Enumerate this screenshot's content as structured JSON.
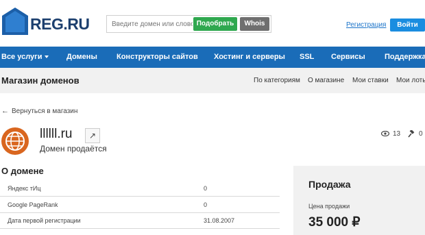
{
  "header": {
    "logo_text": "REG.RU",
    "search_placeholder": "Введите домен или слово",
    "pick_button": "Подобрать",
    "whois_button": "Whois",
    "register_link": "Регистрация",
    "login_button": "Войти"
  },
  "nav": {
    "items": [
      "Все услуги",
      "Домены",
      "Конструкторы сайтов",
      "Хостинг и серверы",
      "SSL",
      "Сервисы",
      "Поддержка"
    ]
  },
  "subbar": {
    "title": "Магазин доменов",
    "links": [
      "По категориям",
      "О магазине",
      "Мои ставки",
      "Мои лоты"
    ]
  },
  "back_link": "Вернуться в магазин",
  "domain": {
    "name": "llllll.ru",
    "status": "Домен продаётся",
    "views": "13",
    "bids": "0"
  },
  "about": {
    "title": "О домене",
    "rows": [
      {
        "key": "Яндекс тИц",
        "value": "0"
      },
      {
        "key": "Google PageRank",
        "value": "0"
      },
      {
        "key": "Дата первой регистрации",
        "value": "31.08.2007"
      }
    ]
  },
  "sale": {
    "title": "Продажа",
    "price_label": "Цена продажи",
    "price": "35 000 ₽"
  },
  "colors": {
    "nav_bg": "#1a6cb8",
    "brand_text": "#1c3f6e",
    "pick_button": "#2fa84f",
    "login_button": "#1a8de0"
  }
}
